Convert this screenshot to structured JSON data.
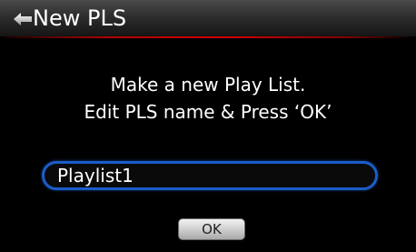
{
  "dialog": {
    "title": "New PLS",
    "title_icon": "back-arrow-diamond-icon",
    "message_line1": "Make a new Play List.",
    "message_line2": "Edit PLS name & Press ‘OK’"
  },
  "playlist_name": {
    "value": "Playlist1"
  },
  "buttons": {
    "ok_label": "OK"
  },
  "colors": {
    "background": "#000000",
    "title_underline": "#d40000",
    "field_border": "#1a5dc8",
    "button_face": "#cfcfcf"
  }
}
